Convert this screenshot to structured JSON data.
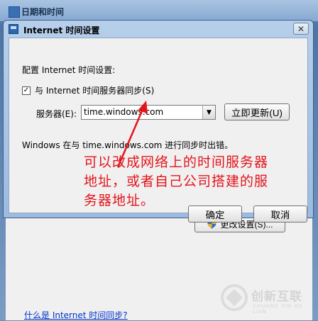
{
  "parent_window": {
    "title": "日期和时间",
    "change_settings_label": "更改设置(S)...",
    "help_link": "什么是 Internet 时间同步?"
  },
  "dialog": {
    "title": "Internet 时间设置",
    "close_glyph": "✕",
    "section_label": "配置 Internet 时间设置:",
    "sync_checkbox": {
      "label": "与 Internet 时间服务器同步(S)",
      "checked": true,
      "glyph": "✓"
    },
    "server_label": "服务器(E):",
    "server_value": "time.windows.com",
    "update_now_label": "立即更新(U)",
    "status_text": "Windows 在与 time.windows.com 进行同步时出错。",
    "ok_label": "确定",
    "cancel_label": "取消"
  },
  "annotation": {
    "lines": [
      "可以改成网络上的时间服务器",
      "地址，或者自己公司搭建的服",
      "务器地址。"
    ],
    "color": "#e4141b"
  },
  "watermark": {
    "brand": "创新互联",
    "sub": "CHUANG XIN HU LIAN"
  },
  "icons": [
    "window-icon",
    "shield-icon",
    "close-icon",
    "dropdown-arrow-icon",
    "checkmark-icon"
  ]
}
